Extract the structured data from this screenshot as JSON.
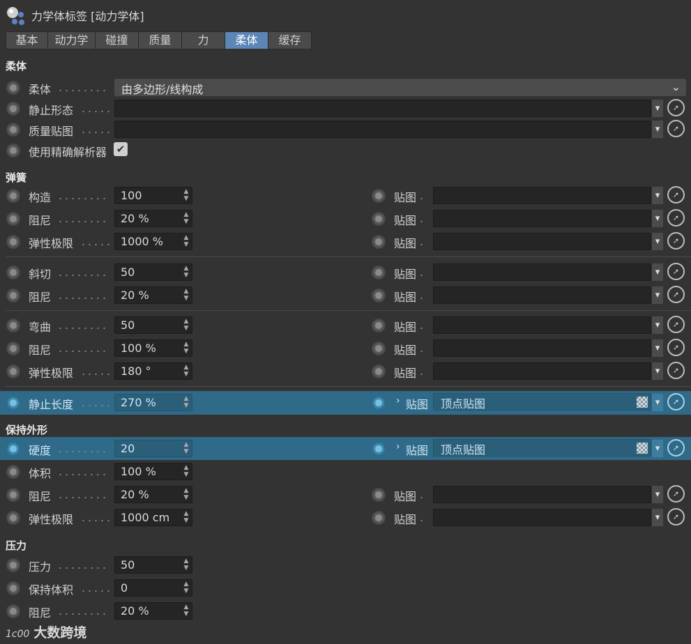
{
  "window": {
    "title": "力学体标签 [动力学体]"
  },
  "tabs": [
    {
      "label": "基本",
      "active": false
    },
    {
      "label": "动力学",
      "active": false
    },
    {
      "label": "碰撞",
      "active": false
    },
    {
      "label": "质量",
      "active": false
    },
    {
      "label": "力",
      "active": false
    },
    {
      "label": "柔体",
      "active": true
    },
    {
      "label": "缓存",
      "active": false
    }
  ],
  "sections": {
    "soft_body": "柔体",
    "springs": "弹簧",
    "shape_conservation": "保持外形",
    "pressure": "压力"
  },
  "soft_body": {
    "mode_label": "柔体",
    "mode_value": "由多边形/线构成",
    "rest_state_label": "静止形态",
    "mass_map_label": "质量贴图",
    "exact_solver_label": "使用精确解析器",
    "exact_solver_checked": true
  },
  "springs": {
    "structural": {
      "label": "构造",
      "value": "100",
      "map_label": "贴图"
    },
    "structural_damping": {
      "label": "阻尼",
      "value": "20 %",
      "map_label": "贴图"
    },
    "structural_limit": {
      "label": "弹性极限",
      "value": "1000 %",
      "map_label": "贴图"
    },
    "shear": {
      "label": "斜切",
      "value": "50",
      "map_label": "贴图"
    },
    "shear_damping": {
      "label": "阻尼",
      "value": "20 %",
      "map_label": "贴图"
    },
    "flexion": {
      "label": "弯曲",
      "value": "50",
      "map_label": "贴图"
    },
    "flexion_damping": {
      "label": "阻尼",
      "value": "100 %",
      "map_label": "贴图"
    },
    "flexion_limit": {
      "label": "弹性极限",
      "value": "180 °",
      "map_label": "贴图"
    },
    "rest_length": {
      "label": "静止长度",
      "value": "270 %",
      "map_label": "贴图",
      "map_value": "顶点贴图"
    }
  },
  "shape": {
    "stiffness": {
      "label": "硬度",
      "value": "20",
      "map_label": "贴图",
      "map_value": "顶点贴图"
    },
    "volume": {
      "label": "体积",
      "value": "100 %"
    },
    "damping": {
      "label": "阻尼",
      "value": "20 %",
      "map_label": "贴图"
    },
    "limit": {
      "label": "弹性极限",
      "value": "1000 cm",
      "map_label": "贴图"
    }
  },
  "pressure": {
    "pressure": {
      "label": "压力",
      "value": "50"
    },
    "keep_volume": {
      "label": "保持体积",
      "value": "0"
    },
    "damping": {
      "label": "阻尼",
      "value": "20 %"
    }
  },
  "watermark": {
    "logo": "1c00",
    "text": "大数跨境"
  },
  "colors": {
    "background": "#333333",
    "active_tab": "#5b86b6",
    "highlight_row": "#2f6a88"
  },
  "icons": [
    "dynamics-tag-icon",
    "radio-icon",
    "chevron-down-icon",
    "picker-arrow-icon",
    "checkmark-icon",
    "checker-texture-icon",
    "expand-arrow-icon"
  ]
}
